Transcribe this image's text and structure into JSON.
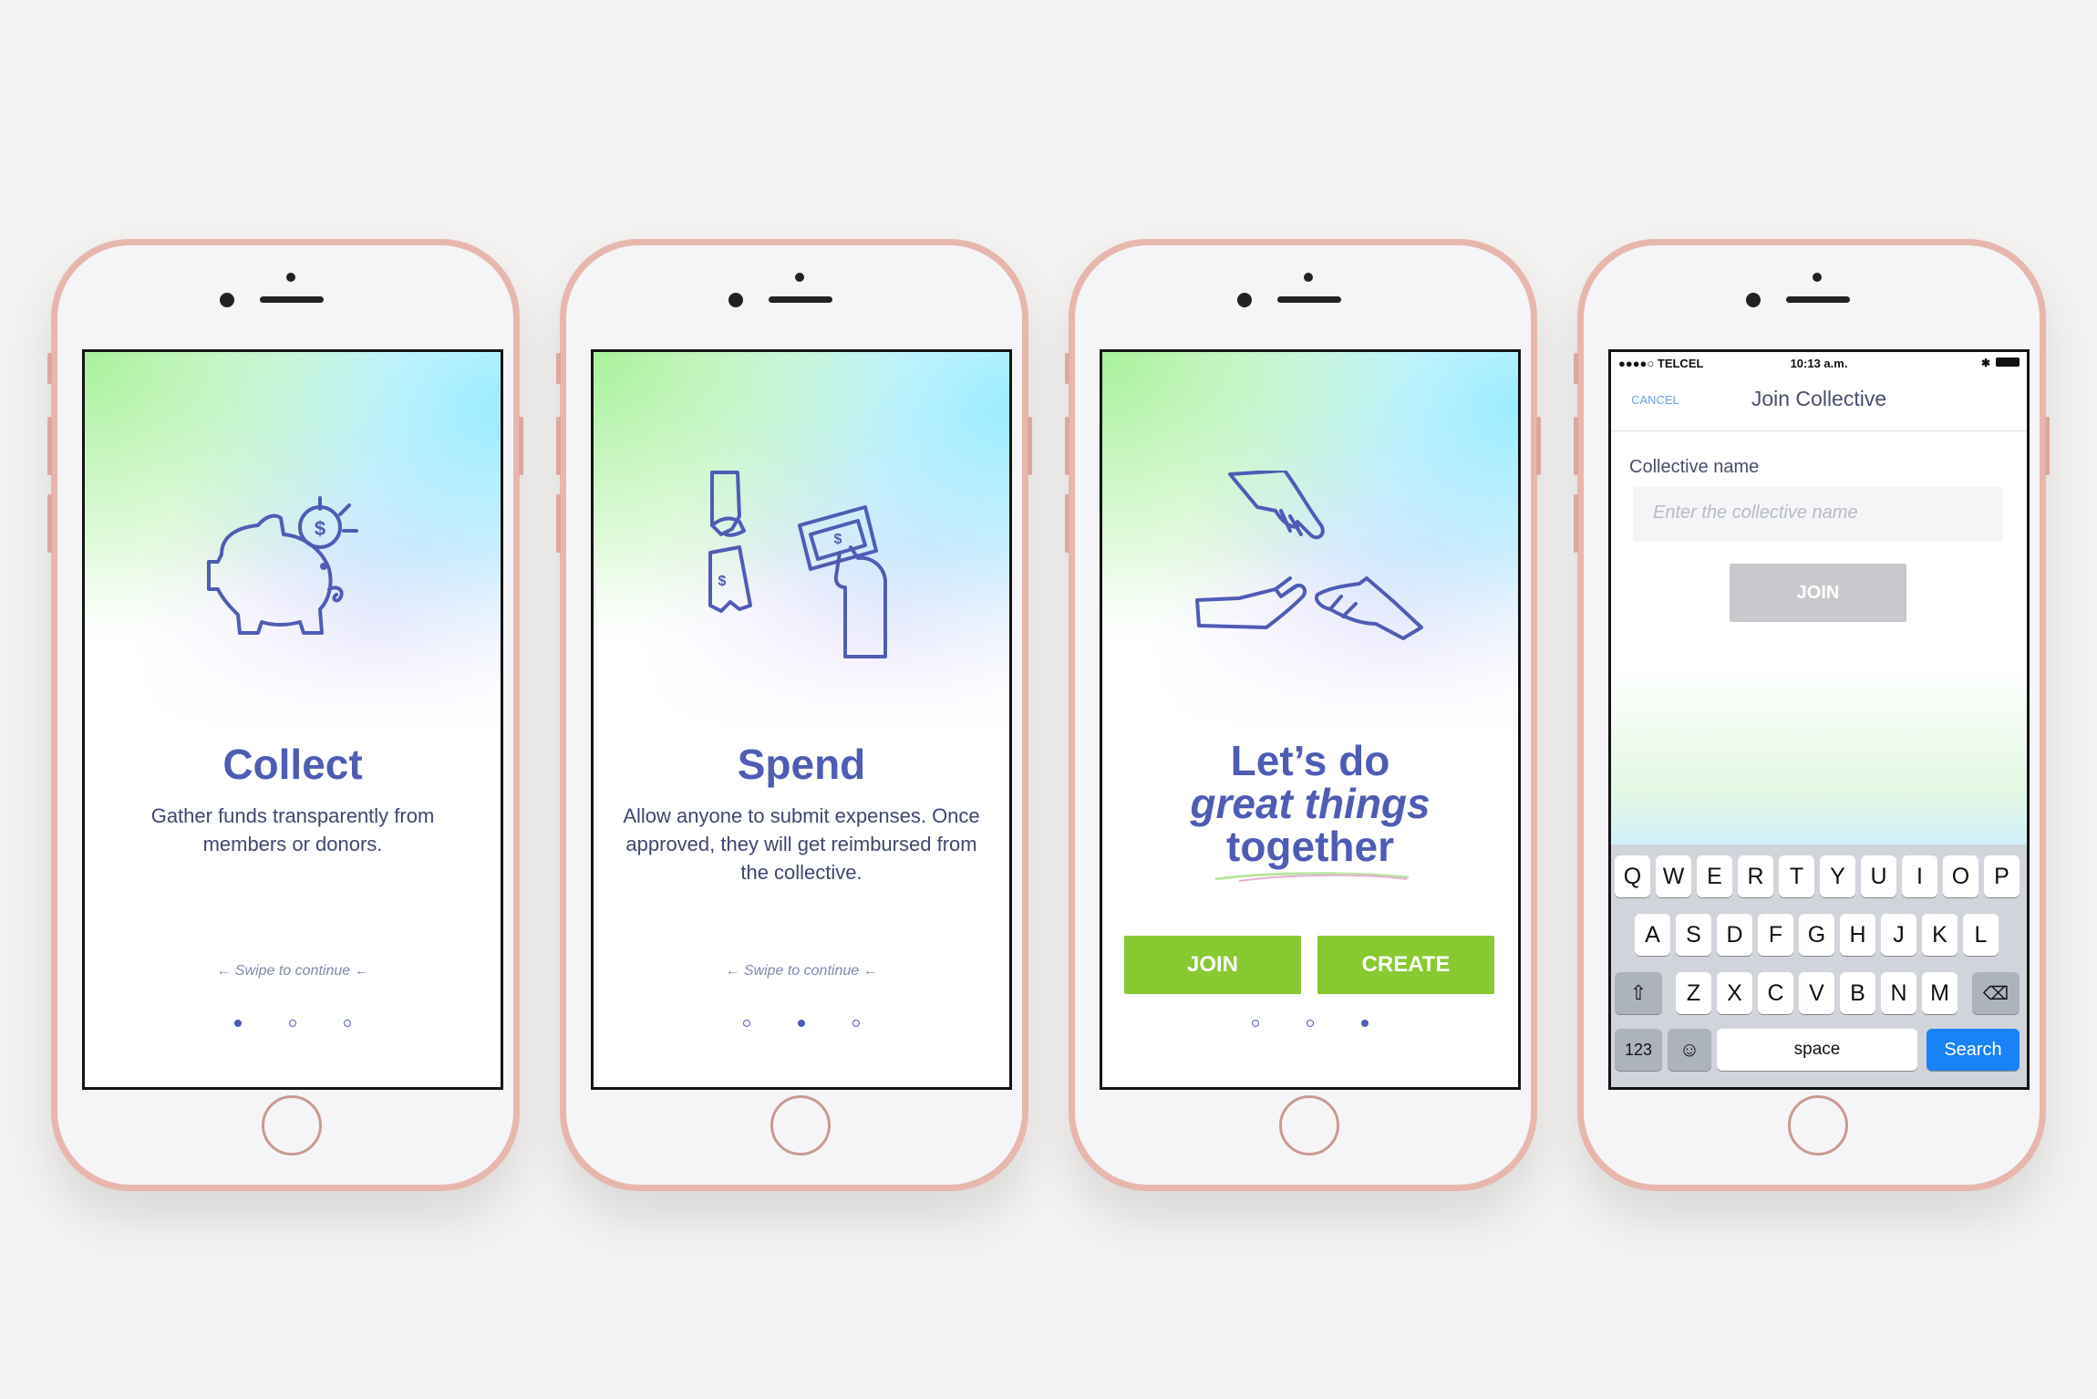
{
  "phones": [
    {
      "title": "Collect",
      "subtitle": "Gather funds transparently from members or donors.",
      "swipe": "← Swipe to continue ←",
      "active_dot": 0,
      "icon": "piggy-bank-icon"
    },
    {
      "title": "Spend",
      "subtitle": "Allow anyone to submit expenses. Once approved, they will get reimbursed from the collective.",
      "swipe": "← Swipe to continue ←",
      "active_dot": 1,
      "icon": "hands-exchange-money-icon"
    },
    {
      "title_line1": "Let’s do",
      "title_line2": "great things",
      "title_line3": "together",
      "join_label": "JOIN",
      "create_label": "CREATE",
      "active_dot": 2,
      "icon": "three-hands-icon"
    },
    {
      "status": {
        "carrier": "●●●●○ TELCEL",
        "time": "10:13 a.m."
      },
      "cancel_label": "CANCEL",
      "nav_title": "Join Collective",
      "field_label": "Collective name",
      "field_placeholder": "Enter the collective name",
      "join_label": "JOIN",
      "keyboard": {
        "row1": [
          "Q",
          "W",
          "E",
          "R",
          "T",
          "Y",
          "U",
          "I",
          "O",
          "P"
        ],
        "row2": [
          "A",
          "S",
          "D",
          "F",
          "G",
          "H",
          "J",
          "K",
          "L"
        ],
        "row3": [
          "Z",
          "X",
          "C",
          "V",
          "B",
          "N",
          "M"
        ],
        "numbers_key": "123",
        "space_key": "space",
        "search_key": "Search"
      }
    }
  ],
  "colors": {
    "accent": "#4f5cb5",
    "cta": "#88c931",
    "body": "#f3f2f0",
    "phone": "#e7b7ae"
  }
}
